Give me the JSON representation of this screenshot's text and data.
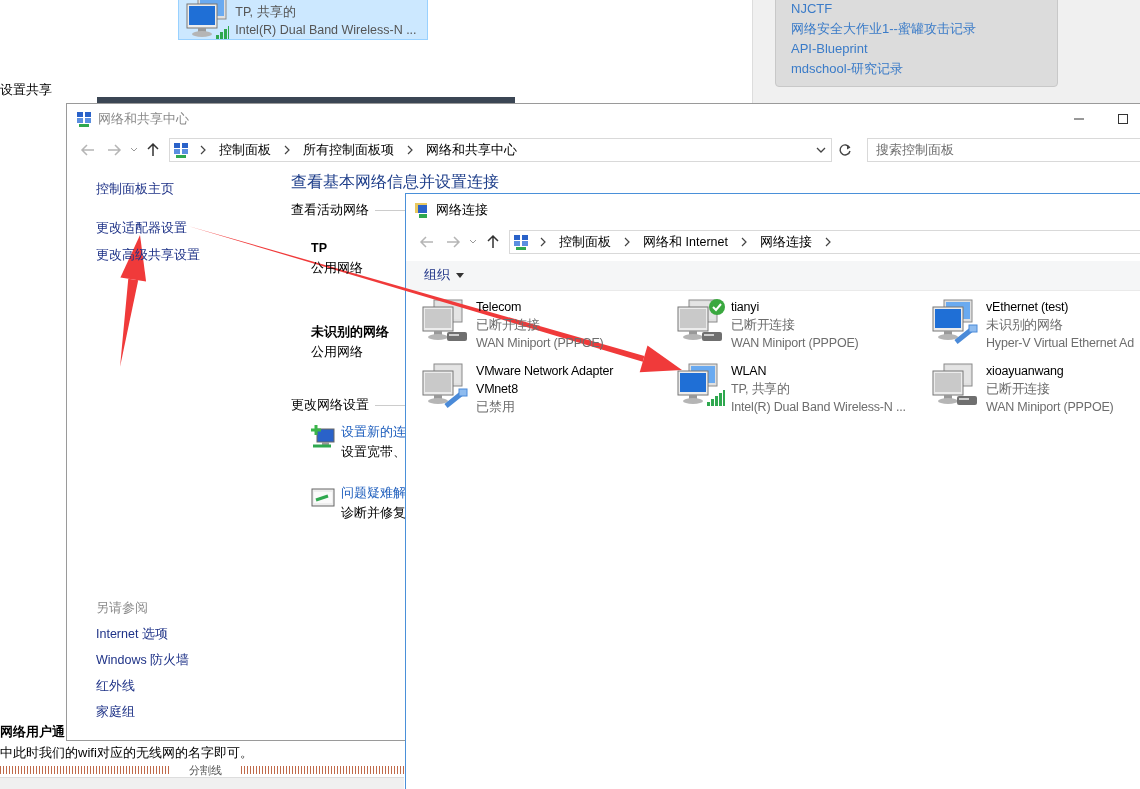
{
  "background_page": {
    "shared_tile": {
      "status": "TP, 共享的",
      "device": "Intel(R) Dual Band Wireless-N ...",
      "selected": true
    },
    "heading_fragment": "设置共享",
    "side_links": [
      "NJCTF",
      "网络安全大作业1--蜜罐攻击记录",
      "API-Blueprint",
      "mdschool-研究记录"
    ],
    "bold_fragment": "网络用户通",
    "paragraph": "中此时我们的wifi对应的无线网的名字即可。",
    "divider_label": "分割线"
  },
  "sharing_center_window": {
    "title": "网络和共享中心",
    "nav": {
      "back_disabled": true,
      "forward_disabled": true
    },
    "breadcrumb": [
      "控制面板",
      "所有控制面板项",
      "网络和共享中心"
    ],
    "search": {
      "placeholder": "搜索控制面板"
    },
    "left_links": [
      "控制面板主页",
      "更改适配器设置",
      "更改高级共享设置"
    ],
    "see_also": {
      "title": "另请参阅",
      "links": [
        "Internet 选项",
        "Windows 防火墙",
        "红外线",
        "家庭组"
      ]
    },
    "heading": "查看基本网络信息并设置连接",
    "active_networks_title": "查看活动网络",
    "networks": [
      {
        "name": "TP",
        "category": "公用网络"
      },
      {
        "name": "未识别的网络",
        "category": "公用网络"
      }
    ],
    "change_settings_title": "更改网络设置",
    "tasks": [
      {
        "kind": "new-connection",
        "link": "设置新的连",
        "description": "设置宽带、"
      },
      {
        "kind": "troubleshoot",
        "link": "问题疑难解",
        "description": "诊断并修复"
      }
    ]
  },
  "connections_window": {
    "title": "网络连接",
    "nav": {
      "back_disabled": true,
      "forward_disabled": true
    },
    "breadcrumb": [
      "控制面板",
      "网络和 Internet",
      "网络连接"
    ],
    "organize_menu": "组织",
    "adapters": [
      {
        "name": "Telecom",
        "status": "已断开连接",
        "device": "WAN Miniport (PPPOE)",
        "kind": "dialup",
        "connected": false,
        "default": false
      },
      {
        "name": "tianyi",
        "status": "已断开连接",
        "device": "WAN Miniport (PPPOE)",
        "kind": "dialup",
        "connected": false,
        "default": true
      },
      {
        "name": "vEthernet (test)",
        "status": "未识别的网络",
        "device": "Hyper-V Virtual Ethernet Ad",
        "kind": "ethernet",
        "connected": true,
        "default": false
      },
      {
        "name": "VMware Network Adapter VMnet8",
        "status": "已禁用",
        "kind": "ethernet",
        "connected": false,
        "default": false
      },
      {
        "name": "WLAN",
        "status": "TP, 共享的",
        "device": "Intel(R) Dual Band Wireless-N ...",
        "kind": "wireless",
        "connected": true,
        "default": false
      },
      {
        "name": "xioayuanwang",
        "status": "已断开连接",
        "device": "WAN Miniport (PPPOE)",
        "kind": "dialup",
        "connected": false,
        "default": false
      }
    ]
  }
}
